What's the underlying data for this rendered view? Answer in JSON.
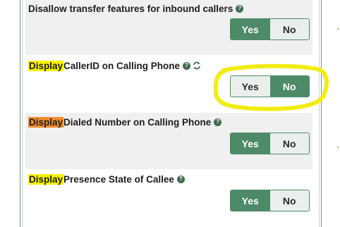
{
  "settings": [
    {
      "label_text": "Disallow transfer features for inbound callers",
      "highlight_word": "",
      "help_icon": "question-circle-icon",
      "yes_label": "Yes",
      "no_label": "No",
      "selected": "Yes"
    },
    {
      "label_prefix": "Display",
      "label_text": " CallerID on Calling Phone",
      "highlight_color": "#f7f200",
      "help_icon": "question-circle-icon",
      "extra_icon": "refresh-icon",
      "yes_label": "Yes",
      "no_label": "No",
      "selected": "No"
    },
    {
      "label_prefix": "Display",
      "label_text": " Dialed Number on Calling Phone",
      "highlight_color": "#f28a2e",
      "help_icon": "question-circle-icon",
      "yes_label": "Yes",
      "no_label": "No",
      "selected": "Yes"
    },
    {
      "label_prefix": "Display",
      "label_text": " Presence State of Callee",
      "highlight_color": "#f7f200",
      "help_icon": "question-circle-icon",
      "yes_label": "Yes",
      "no_label": "No",
      "selected": "Yes"
    }
  ],
  "help_glyph": "?",
  "annotation_color": "#f2ec13",
  "toggle_on_color": "#4d8a67",
  "toggle_off_color": "#e9f0ec"
}
